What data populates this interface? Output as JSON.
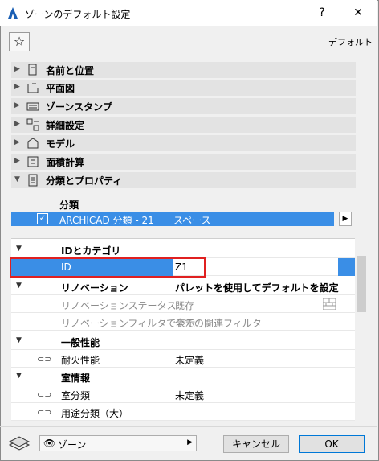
{
  "window": {
    "title": "ゾーンのデフォルト設定",
    "help": "?",
    "close": "✕"
  },
  "toolbar": {
    "favorites_icon": "star-icon",
    "default_label": "デフォルト"
  },
  "sections": [
    {
      "label": "名前と位置",
      "icon": "name-position-icon",
      "expanded": false
    },
    {
      "label": "平面図",
      "icon": "floorplan-icon",
      "expanded": false
    },
    {
      "label": "ゾーンスタンプ",
      "icon": "zone-stamp-icon",
      "expanded": false
    },
    {
      "label": "詳細設定",
      "icon": "detail-settings-icon",
      "expanded": false
    },
    {
      "label": "モデル",
      "icon": "model-icon",
      "expanded": false
    },
    {
      "label": "面積計算",
      "icon": "area-calc-icon",
      "expanded": false
    },
    {
      "label": "分類とプロパティ",
      "icon": "classification-icon",
      "expanded": true
    }
  ],
  "classification": {
    "header": "分類",
    "row": {
      "checked": true,
      "system": "ARCHICAD 分類 - 21",
      "value": "スペース"
    }
  },
  "properties": {
    "id_category": "IDとカテゴリ",
    "id_label": "ID",
    "id_value": "Z1",
    "renovation": "リノベーション",
    "renovation_value": "パレットを使用してデフォルトを設定",
    "reno_status_label": "リノベーションステータス",
    "reno_status_value": "既存",
    "reno_filter_label": "リノベーションフィルタで表示",
    "reno_filter_value": "全ての関連フィルタ",
    "general": "一般性能",
    "fire_label": "耐火性能",
    "fire_value": "未定義",
    "room_info": "室情報",
    "room_class_label": "室分類",
    "room_class_value": "未定義",
    "usage_label": "用途分類（大）",
    "usage_value": ""
  },
  "footer": {
    "layer_label": "ゾーン",
    "cancel": "キャンセル",
    "ok": "OK"
  },
  "colors": {
    "selection": "#3a8ee6",
    "highlight_border": "#e02020",
    "ok_border": "#0078d7"
  }
}
